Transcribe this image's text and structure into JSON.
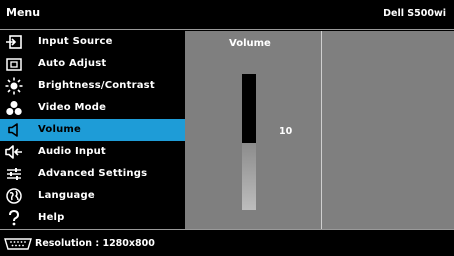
{
  "header": {
    "title": "Menu",
    "model": "Dell  S500wi"
  },
  "menu": {
    "items": [
      {
        "label": "Input Source",
        "icon": "input-source-icon",
        "active": false
      },
      {
        "label": "Auto Adjust",
        "icon": "auto-adjust-icon",
        "active": false
      },
      {
        "label": "Brightness/Contrast",
        "icon": "brightness-icon",
        "active": false
      },
      {
        "label": "Video Mode",
        "icon": "video-mode-icon",
        "active": false
      },
      {
        "label": "Volume",
        "icon": "volume-icon",
        "active": true
      },
      {
        "label": "Audio Input",
        "icon": "audio-input-icon",
        "active": false
      },
      {
        "label": "Advanced Settings",
        "icon": "advanced-settings-icon",
        "active": false
      },
      {
        "label": "Language",
        "icon": "language-icon",
        "active": false
      },
      {
        "label": "Help",
        "icon": "help-icon",
        "active": false
      }
    ]
  },
  "panel": {
    "title": "Volume",
    "value": "10",
    "level_fraction": 0.49
  },
  "footer": {
    "resolution": "Resolution : 1280x800"
  },
  "colors": {
    "active": "#1e9cd7",
    "panel": "#7f7f7f",
    "background": "#000000"
  }
}
